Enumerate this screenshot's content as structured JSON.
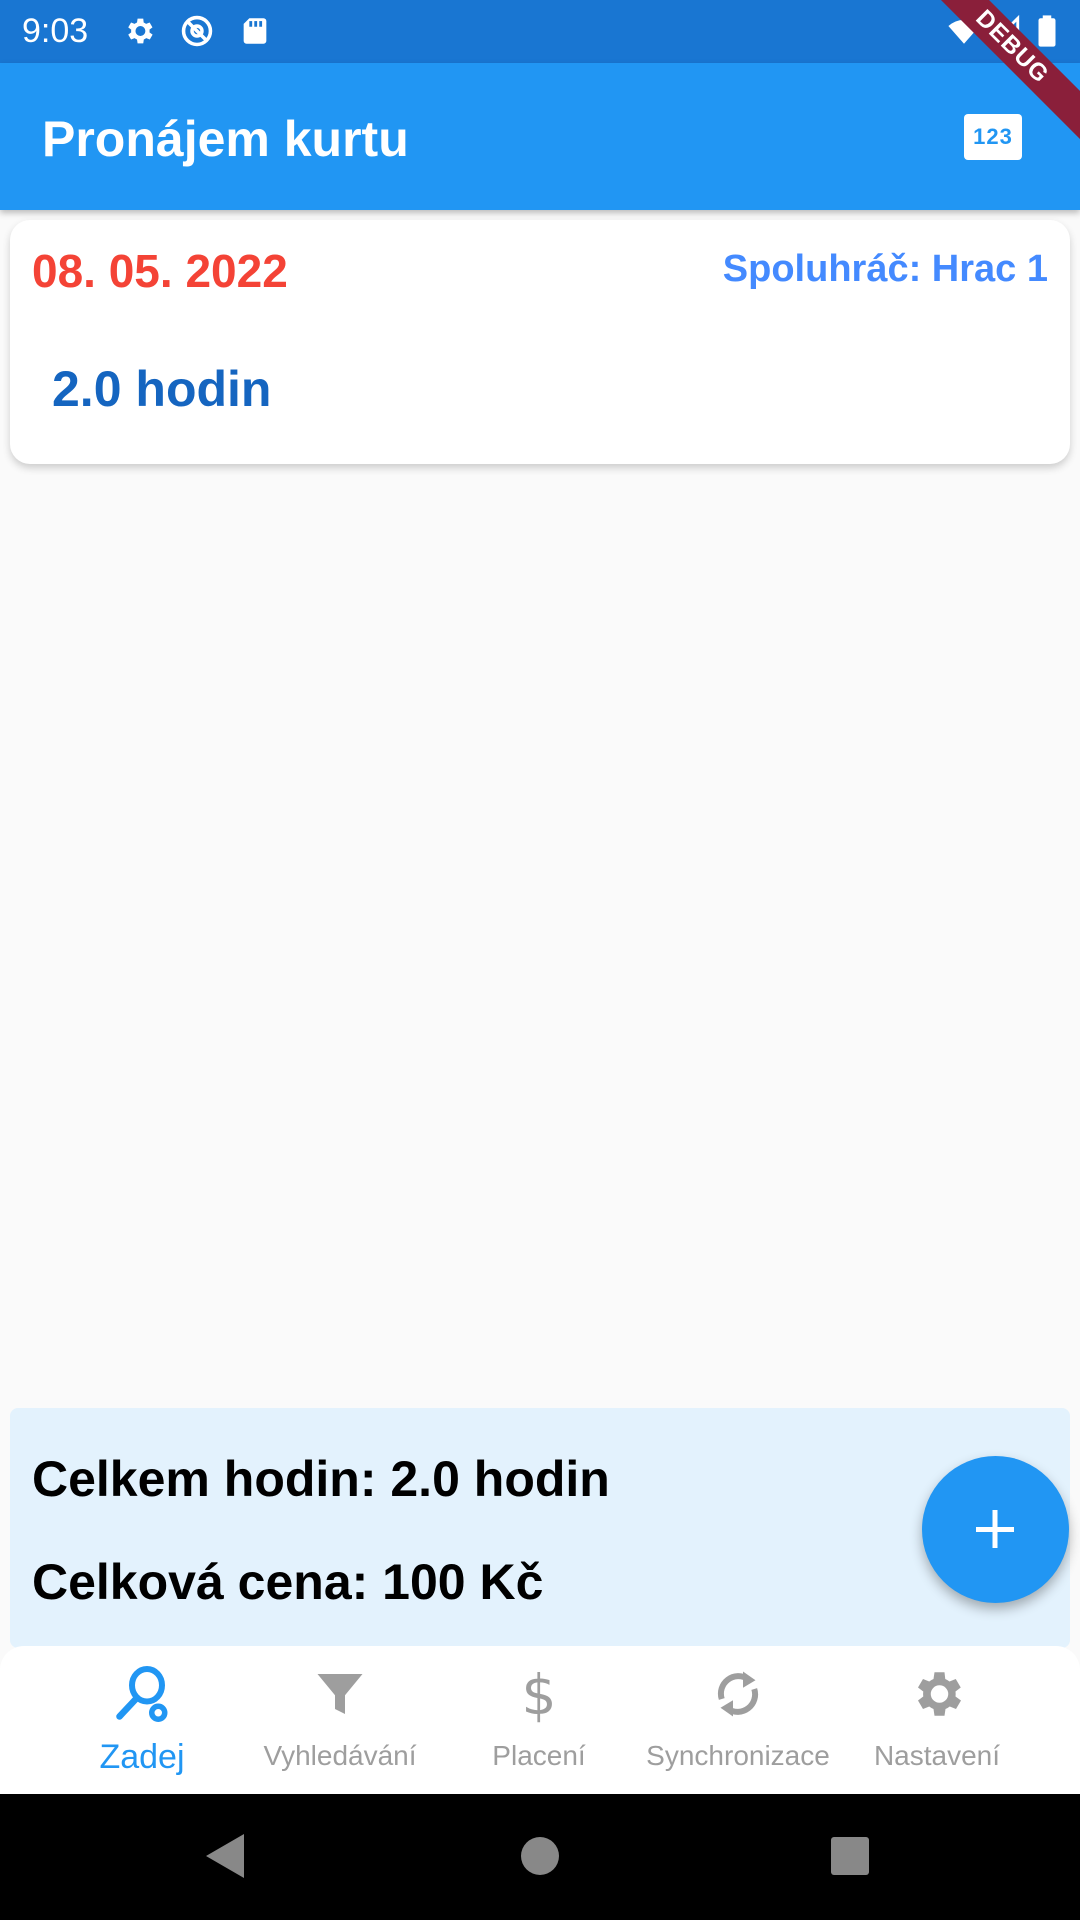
{
  "status_bar": {
    "time": "9:03",
    "icons": [
      "settings-icon",
      "at-sign-icon",
      "sd-card-icon",
      "wifi-icon",
      "signal-icon",
      "battery-icon"
    ]
  },
  "debug_banner": "DEBUG",
  "app_bar": {
    "title": "Pronájem kurtu",
    "action_label": "123",
    "action_icon": "numbers-icon"
  },
  "entry": {
    "date": "08. 05. 2022",
    "partner": "Spoluhráč: Hrac 1",
    "hours": "2.0 hodin"
  },
  "summary": {
    "total_hours": "Celkem hodin: 2.0 hodin",
    "total_price": "Celková cena: 100 Kč"
  },
  "fab": {
    "icon": "plus-icon"
  },
  "bottom_nav": {
    "items": [
      {
        "label": "Zadej",
        "icon": "tennis-racket-icon",
        "active": true
      },
      {
        "label": "Vyhledávání",
        "icon": "filter-icon",
        "active": false
      },
      {
        "label": "Placení",
        "icon": "dollar-icon",
        "active": false
      },
      {
        "label": "Synchronizace",
        "icon": "sync-icon",
        "active": false
      },
      {
        "label": "Nastavení",
        "icon": "gear-icon",
        "active": false
      }
    ]
  },
  "colors": {
    "status_bar": "#1976d2",
    "app_bar": "#2196f3",
    "date_red": "#f44336",
    "partner_blue": "#448aff",
    "hours_blue": "#1565c0",
    "summary_bg": "#e3f2fd",
    "inactive": "#9e9e9e"
  }
}
